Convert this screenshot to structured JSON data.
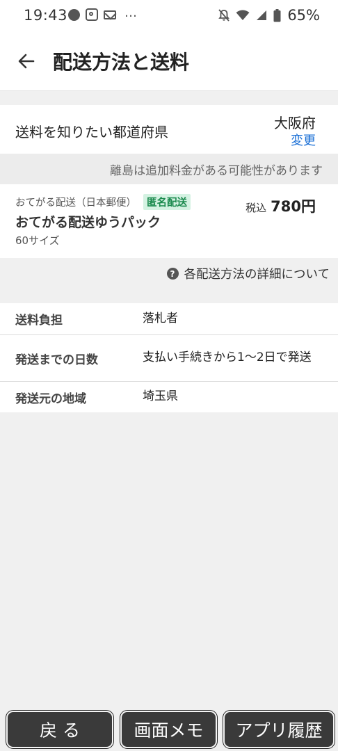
{
  "status": {
    "time": "19:43",
    "battery": "65%"
  },
  "header": {
    "title": "配送方法と送料"
  },
  "prefecture": {
    "label": "送料を知りたい都道府県",
    "value": "大阪府",
    "change_label": "変更"
  },
  "notice": "離島は追加料金がある可能性があります",
  "method": {
    "sub_label": "おてがる配送（日本郵便）",
    "badge": "匿名配送",
    "tax_label": "税込",
    "price": "780円",
    "name": "おてがる配送ゆうパック",
    "size": "60サイズ"
  },
  "detail_link": "各配送方法の詳細について",
  "info": [
    {
      "label": "送料負担",
      "value": "落札者"
    },
    {
      "label": "発送までの日数",
      "value": "支払い手続きから1〜2日で発送"
    },
    {
      "label": "発送元の地域",
      "value": "埼玉県"
    }
  ],
  "bottom_buttons": {
    "back": "戻 る",
    "memo": "画面メモ",
    "history": "アプリ履歴"
  }
}
